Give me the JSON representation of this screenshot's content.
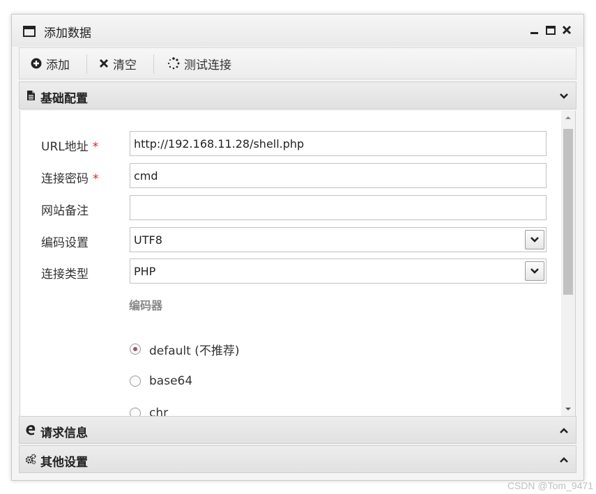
{
  "window": {
    "title": "添加数据"
  },
  "toolbar": {
    "add_label": "添加",
    "clear_label": "清空",
    "test_label": "测试连接"
  },
  "panels": {
    "basic": {
      "title": "基础配置"
    },
    "request": {
      "title": "请求信息"
    },
    "other": {
      "title": "其他设置"
    }
  },
  "form": {
    "url": {
      "label": "URL地址",
      "value": "http://192.168.11.28/shell.php",
      "required_mark": "*"
    },
    "password": {
      "label": "连接密码",
      "value": "cmd",
      "required_mark": "*"
    },
    "note": {
      "label": "网站备注",
      "value": ""
    },
    "encoding": {
      "label": "编码设置",
      "value": "UTF8"
    },
    "type": {
      "label": "连接类型",
      "value": "PHP"
    }
  },
  "encoder": {
    "title": "编码器",
    "options": [
      {
        "label": "default (不推荐)",
        "checked": true
      },
      {
        "label": "base64",
        "checked": false
      },
      {
        "label": "chr",
        "checked": false
      }
    ]
  },
  "watermark": "CSDN @Tom_9471",
  "colors": {
    "required": "#e02020",
    "radio_checked": "#a0566a"
  }
}
